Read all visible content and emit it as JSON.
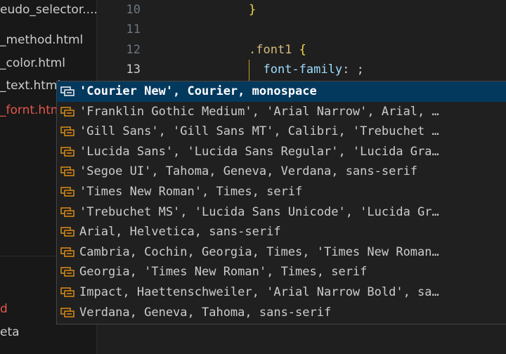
{
  "sidebar": {
    "files": [
      "eudo_selector....",
      "_method.html",
      "_color.html",
      "_text.html",
      "_fornt.html"
    ],
    "active_index": 4,
    "bottom_items": [
      "d",
      "eta"
    ]
  },
  "editor": {
    "line_numbers": [
      "10",
      "11",
      "12",
      "13"
    ],
    "current_line": "13",
    "lines": {
      "l10_brace": "}",
      "l12_selector": ".font1",
      "l12_brace": "{",
      "l13_property": "font-family",
      "l13_colon": ":",
      "l13_semicolon": ";"
    }
  },
  "suggest": {
    "items": [
      "'Courier New', Courier, monospace",
      "'Franklin Gothic Medium', 'Arial Narrow', Arial, …",
      "'Gill Sans', 'Gill Sans MT', Calibri, 'Trebuchet …",
      "'Lucida Sans', 'Lucida Sans Regular', 'Lucida Gra…",
      "'Segoe UI', Tahoma, Geneva, Verdana, sans-serif",
      "'Times New Roman', Times, serif",
      "'Trebuchet MS', 'Lucida Sans Unicode', 'Lucida Gr…",
      "Arial, Helvetica, sans-serif",
      "Cambria, Cochin, Georgia, Times, 'Times New Roman…",
      "Georgia, 'Times New Roman', Times, serif",
      "Impact, Haettenschweiler, 'Arial Narrow Bold', sa…",
      "Verdana, Geneva, Tahoma, sans-serif"
    ],
    "selected_index": 0,
    "item_icon": "snippet-icon"
  },
  "colors": {
    "accent_selected": "#04395e",
    "icon_orange": "#d18616",
    "active_file": "#e2564b",
    "brace_yellow": "#f9d849",
    "property_blue": "#9cdcfe"
  }
}
